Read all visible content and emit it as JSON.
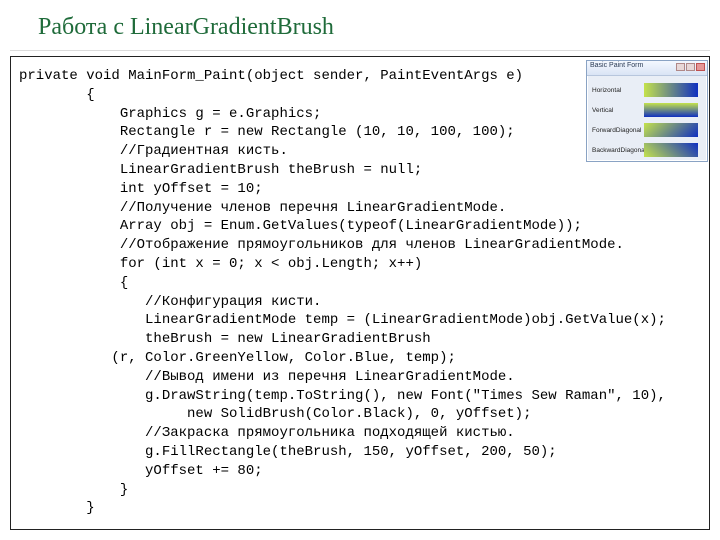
{
  "title": "Работа с LinearGradientBrush",
  "code_lines": [
    "private void MainForm_Paint(object sender, PaintEventArgs e)",
    "        {",
    "            Graphics g = e.Graphics;",
    "            Rectangle r = new Rectangle (10, 10, 100, 100);",
    "            //Градиентная кисть.",
    "            LinearGradientBrush theBrush = null;",
    "            int yOffset = 10;",
    "            //Получение членов перечня LinearGradientMode.",
    "            Array obj = Enum.GetValues(typeof(LinearGradientMode));",
    "            //Отображение прямоугольников для членов LinearGradientMode.",
    "            for (int x = 0; x < obj.Length; x++)",
    "            {",
    "               //Конфигурация кисти.",
    "               LinearGradientMode temp = (LinearGradientMode)obj.GetValue(x);",
    "               theBrush = new LinearGradientBrush",
    "           (r, Color.GreenYellow, Color.Blue, temp);",
    "               //Вывод имени из перечня LinearGradientMode.",
    "               g.DrawString(temp.ToString(), new Font(\"Times Sew Raman\", 10),",
    "                    new SolidBrush(Color.Black), 0, yOffset);",
    "               //Закраска прямоугольника подходящей кистью.",
    "               g.FillRectangle(theBrush, 150, yOffset, 200, 50);",
    "               yOffset += 80;",
    "            }",
    "        }"
  ],
  "thumb": {
    "window_title": "Basic Paint Form",
    "rows": [
      {
        "label": "Horizontal",
        "mode": "h"
      },
      {
        "label": "Vertical",
        "mode": "v"
      },
      {
        "label": "ForwardDiagonal",
        "mode": "fd"
      },
      {
        "label": "BackwardDiagonal",
        "mode": "bd"
      }
    ]
  }
}
